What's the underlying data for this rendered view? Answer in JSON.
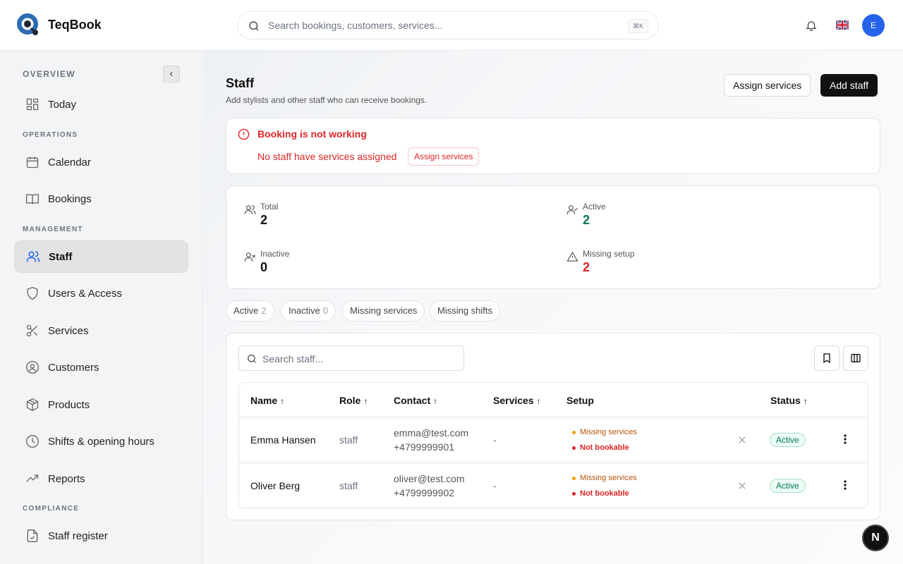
{
  "app": {
    "brand": "TeqBook",
    "search_placeholder": "Search bookings, customers, services...",
    "search_shortcut": "⌘K",
    "avatar_initial": "E"
  },
  "sidebar": {
    "sections": {
      "overview": "OVERVIEW",
      "operations": "OPERATIONS",
      "management": "MANAGEMENT",
      "compliance": "COMPLIANCE"
    },
    "items": [
      {
        "label": "Today",
        "icon": "dashboard-icon"
      },
      {
        "label": "Calendar",
        "icon": "calendar-icon"
      },
      {
        "label": "Bookings",
        "icon": "book-icon"
      },
      {
        "label": "Staff",
        "icon": "users-icon",
        "active": true
      },
      {
        "label": "Users & Access",
        "icon": "shield-icon"
      },
      {
        "label": "Services",
        "icon": "scissors-icon"
      },
      {
        "label": "Customers",
        "icon": "user-circle-icon"
      },
      {
        "label": "Products",
        "icon": "package-icon"
      },
      {
        "label": "Shifts & opening hours",
        "icon": "clock-icon"
      },
      {
        "label": "Reports",
        "icon": "trending-up-icon"
      },
      {
        "label": "Staff register",
        "icon": "file-check-icon"
      }
    ]
  },
  "page": {
    "title": "Staff",
    "subtitle": "Add stylists and other staff who can receive bookings.",
    "assign_services_label": "Assign services",
    "add_staff_label": "Add staff"
  },
  "alert": {
    "title": "Booking is not working",
    "description": "No staff have services assigned",
    "action_label": "Assign services"
  },
  "stats": {
    "total": {
      "label": "Total",
      "value": "2"
    },
    "active": {
      "label": "Active",
      "value": "2"
    },
    "inactive": {
      "label": "Inactive",
      "value": "0"
    },
    "missing_setup": {
      "label": "Missing setup",
      "value": "2"
    }
  },
  "filters": [
    {
      "label": "Active",
      "count": "2"
    },
    {
      "label": "Inactive",
      "count": "0"
    },
    {
      "label": "Missing services"
    },
    {
      "label": "Missing shifts"
    }
  ],
  "table": {
    "search_placeholder": "Search staff...",
    "columns": {
      "name": "Name",
      "role": "Role",
      "contact": "Contact",
      "services": "Services",
      "setup": "Setup",
      "status": "Status"
    },
    "sort_arrow": "↑",
    "rows": [
      {
        "name": "Emma Hansen",
        "role": "staff",
        "email": "emma@test.com",
        "phone": "+4799999901",
        "services": "-",
        "setup_warning": "Missing services",
        "setup_error": "Not bookable",
        "status": "Active"
      },
      {
        "name": "Oliver Berg",
        "role": "staff",
        "email": "oliver@test.com",
        "phone": "+4799999902",
        "services": "-",
        "setup_warning": "Missing services",
        "setup_error": "Not bookable",
        "status": "Active"
      }
    ]
  },
  "nextjs_badge": "N",
  "colors": {
    "danger": "#dc2626",
    "success": "#047857",
    "warning": "#b45309",
    "accent": "#2563eb"
  }
}
